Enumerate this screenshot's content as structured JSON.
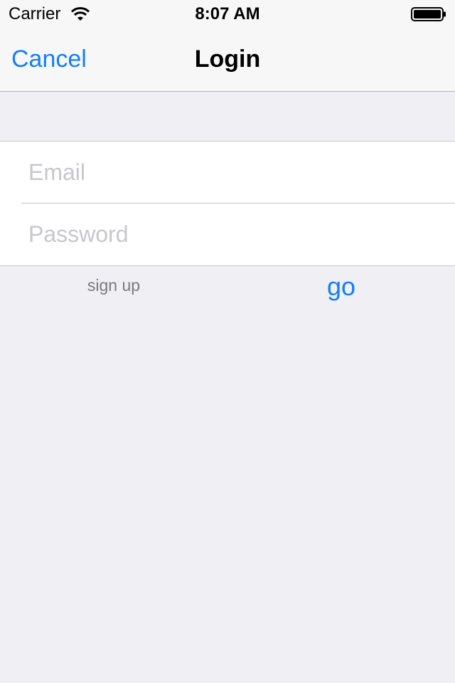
{
  "status_bar": {
    "carrier": "Carrier",
    "time": "8:07 AM",
    "wifi_icon": "wifi-icon",
    "battery_icon": "battery-full-icon",
    "battery_level": 1.0
  },
  "nav_bar": {
    "cancel_label": "Cancel",
    "title": "Login"
  },
  "form": {
    "email": {
      "placeholder": "Email",
      "value": ""
    },
    "password": {
      "placeholder": "Password",
      "value": ""
    }
  },
  "actions": {
    "signup_label": "sign up",
    "go_label": "go"
  },
  "colors": {
    "accent": "#147efb",
    "background": "#efeff4",
    "bar_background": "#f7f7f7",
    "placeholder": "#c7c7cd",
    "secondary_text": "#7b7b7b",
    "separator": "#c8c7cc"
  }
}
